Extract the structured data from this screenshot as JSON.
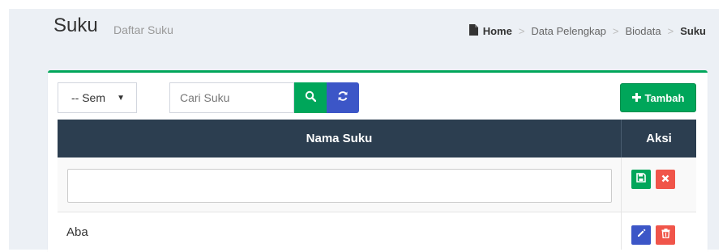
{
  "header": {
    "title": "Suku",
    "subtitle": "Daftar Suku"
  },
  "breadcrumb": {
    "home": "Home",
    "sep": ">",
    "items": [
      "Data Pelengkap",
      "Biodata"
    ],
    "active": "Suku"
  },
  "toolbar": {
    "select_value": "-- Sem",
    "search_placeholder": "Cari Suku",
    "add_label": "Tambah"
  },
  "table": {
    "columns": [
      "Nama Suku",
      "Aksi"
    ],
    "rows": [
      {
        "name": "Aba"
      }
    ]
  },
  "icons": {
    "breadcrumb": "file-icon",
    "search": "search-icon",
    "refresh": "refresh-icon",
    "add": "plus-icon",
    "save": "save-icon",
    "cancel": "close-icon",
    "edit": "pencil-icon",
    "delete": "trash-icon"
  },
  "colors": {
    "primary_green": "#00a65a",
    "primary_blue": "#3c56c7",
    "danger_red": "#f0554a",
    "header_dark": "#2c3e50"
  }
}
